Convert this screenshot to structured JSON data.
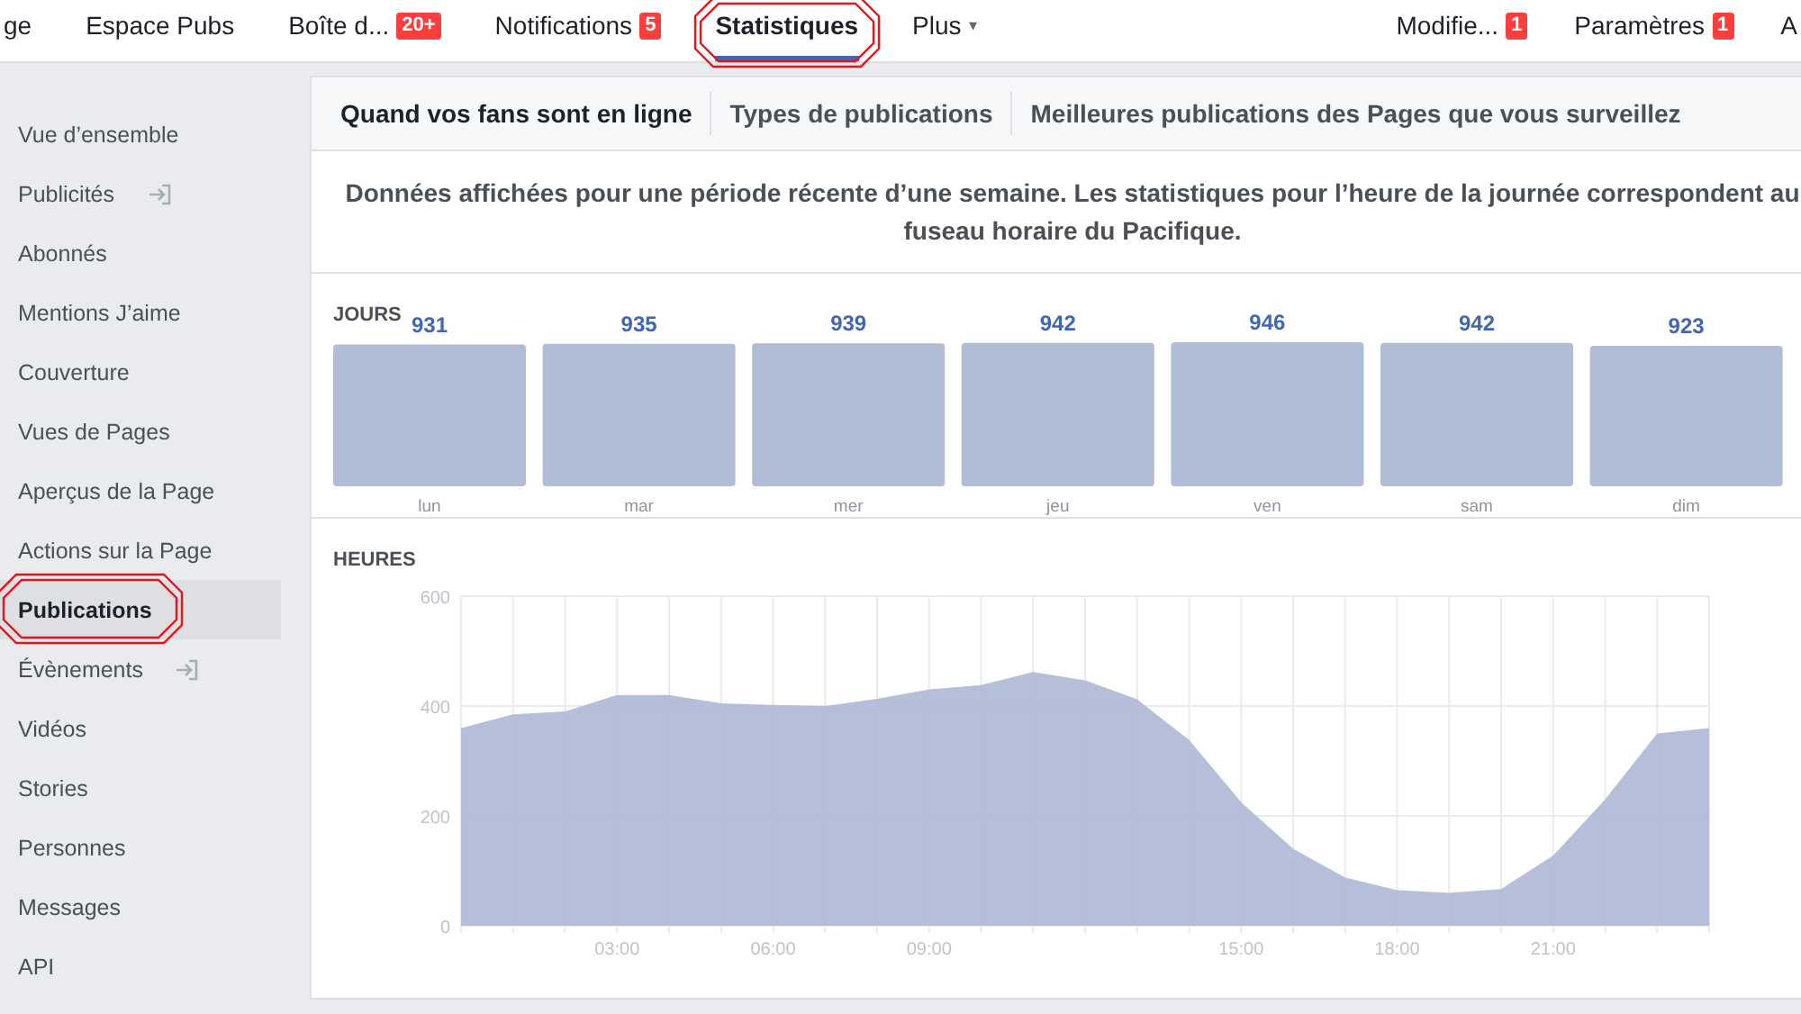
{
  "nav": {
    "items": [
      {
        "label": "ge",
        "selected": false,
        "highlighted": false
      },
      {
        "label": "Espace Pubs",
        "selected": false,
        "highlighted": false
      },
      {
        "label": "Boîte d...",
        "badge": "20+",
        "selected": false,
        "highlighted": false
      },
      {
        "label": "Notifications",
        "badge": "5",
        "selected": false,
        "highlighted": false
      },
      {
        "label": "Statistiques",
        "selected": true,
        "highlighted": true
      },
      {
        "label": "Plus",
        "caret": "▾",
        "selected": false,
        "highlighted": false
      }
    ],
    "right_items": [
      {
        "label": "Modifie...",
        "badge": "1"
      },
      {
        "label": "Paramètres",
        "badge": "1"
      },
      {
        "label": "A"
      }
    ]
  },
  "sidebar": {
    "items": [
      {
        "label": "Vue d’ensemble",
        "selected": false,
        "highlighted": false,
        "external": false
      },
      {
        "label": "Publicités",
        "selected": false,
        "highlighted": false,
        "external": true
      },
      {
        "label": "Abonnés",
        "selected": false,
        "highlighted": false,
        "external": false
      },
      {
        "label": "Mentions J’aime",
        "selected": false,
        "highlighted": false,
        "external": false
      },
      {
        "label": "Couverture",
        "selected": false,
        "highlighted": false,
        "external": false
      },
      {
        "label": "Vues de Pages",
        "selected": false,
        "highlighted": false,
        "external": false
      },
      {
        "label": "Aperçus de la Page",
        "selected": false,
        "highlighted": false,
        "external": false
      },
      {
        "label": "Actions sur la Page",
        "selected": false,
        "highlighted": false,
        "external": false
      },
      {
        "label": "Publications",
        "selected": true,
        "highlighted": true,
        "external": false
      },
      {
        "label": "Évènements",
        "selected": false,
        "highlighted": false,
        "external": true
      },
      {
        "label": "Vidéos",
        "selected": false,
        "highlighted": false,
        "external": false
      },
      {
        "label": "Stories",
        "selected": false,
        "highlighted": false,
        "external": false
      },
      {
        "label": "Personnes",
        "selected": false,
        "highlighted": false,
        "external": false
      },
      {
        "label": "Messages",
        "selected": false,
        "highlighted": false,
        "external": false
      },
      {
        "label": "API",
        "selected": false,
        "highlighted": false,
        "external": false
      }
    ]
  },
  "insights": {
    "tabs": [
      {
        "label": "Quand vos fans sont en ligne",
        "selected": true
      },
      {
        "label": "Types de publications",
        "selected": false
      },
      {
        "label": "Meilleures publications des Pages que vous surveillez",
        "selected": false
      }
    ],
    "description": "Données affichées pour une période récente d’une semaine. Les statistiques pour l’heure de la journée correspondent au fuseau horaire du Pacifique.",
    "days": {
      "title": "JOURS",
      "chart_data": {
        "type": "bar",
        "categories": [
          "lun",
          "mar",
          "mer",
          "jeu",
          "ven",
          "sam",
          "dim"
        ],
        "values": [
          931,
          935,
          939,
          942,
          946,
          942,
          923
        ],
        "data_labels": true
      }
    },
    "hours": {
      "title": "HEURES",
      "chart_data": {
        "type": "area",
        "x": [
          0,
          1,
          2,
          3,
          4,
          5,
          6,
          7,
          8,
          9,
          10,
          11,
          12,
          13,
          14,
          15,
          16,
          17,
          18,
          19,
          20,
          21,
          22,
          23,
          24
        ],
        "values": [
          360,
          385,
          390,
          420,
          420,
          405,
          402,
          400,
          413,
          430,
          438,
          462,
          447,
          412,
          338,
          225,
          140,
          88,
          65,
          60,
          67,
          128,
          230,
          350,
          360
        ],
        "grid": true,
        "xlim": [
          0,
          24
        ],
        "ylim": [
          0,
          600
        ],
        "xticks": [
          {
            "value": 3,
            "label": "03:00"
          },
          {
            "value": 6,
            "label": "06:00"
          },
          {
            "value": 9,
            "label": "09:00"
          },
          {
            "value": 15,
            "label": "15:00"
          },
          {
            "value": 18,
            "label": "18:00"
          },
          {
            "value": 21,
            "label": "21:00"
          }
        ],
        "yticks": [
          0,
          200,
          400,
          600
        ]
      }
    }
  }
}
